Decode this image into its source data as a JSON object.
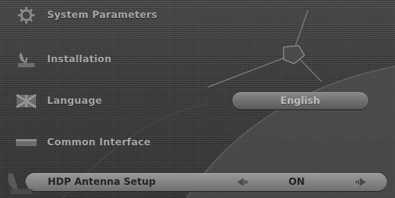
{
  "menu": {
    "items": [
      {
        "label": "System Parameters",
        "icon": "gear-icon"
      },
      {
        "label": "Installation",
        "icon": "dish-installation-icon"
      },
      {
        "label": "Language",
        "icon": "language-flag-icon"
      },
      {
        "label": "Common Interface",
        "icon": "ci-card-icon"
      }
    ],
    "language_value": "English",
    "selected": {
      "label": "HDP Antenna Setup",
      "value": "ON",
      "icon": "antenna-icon"
    }
  }
}
